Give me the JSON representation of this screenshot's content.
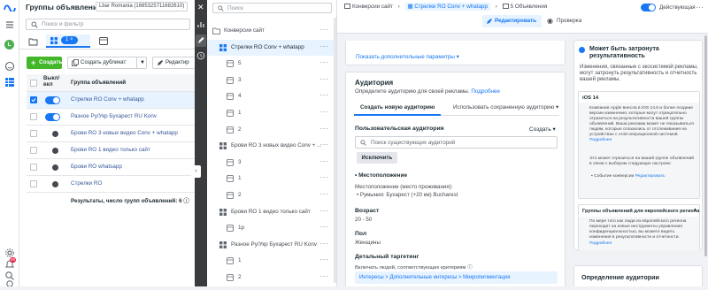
{
  "rail": {
    "icons": [
      "meta-logo-icon",
      "menu-icon",
      "avatar",
      "smile-icon",
      "grid-icon",
      "settings-icon",
      "notifications-icon",
      "search-icon",
      "help-icon",
      "bug-icon"
    ],
    "avatar_letter": "L",
    "notif_count": "99"
  },
  "left_panel": {
    "title": "Группы объявлений",
    "account": "Lbar Romania (1685325711682610)",
    "search_placeholder": "Поиск и фильтр",
    "selected_count": "1",
    "toolbar": {
      "create": "Создать",
      "duplicate": "Создать дубликат",
      "edit": "Редактир"
    },
    "table": {
      "header_toggle": "Выкл/ вкл",
      "header_name": "Группа объявлений",
      "rows": [
        {
          "name": "Стрелки RO Conv + whatapp",
          "on": true,
          "selected": true
        },
        {
          "name": "Разное Ру/Укр Бухарест RU Konv",
          "on": true,
          "selected": false
        },
        {
          "name": "Брови RO 3 новых видео Conv + whatapp",
          "on": false,
          "selected": false
        },
        {
          "name": "Брови RO 1 видео только сайт",
          "on": false,
          "selected": false
        },
        {
          "name": "Брови RO whatsapp",
          "on": false,
          "selected": false
        },
        {
          "name": "Стрелки RO",
          "on": false,
          "selected": false
        }
      ],
      "footer": "Результаты, число групп объявлений: 6"
    }
  },
  "tree": {
    "search_placeholder": "Поиск",
    "nodes": [
      {
        "label": "Конверсии сайт",
        "type": "campaign",
        "indent": 0,
        "selected": false
      },
      {
        "label": "Стрелки RO Conv + whatapp",
        "type": "adset",
        "indent": 1,
        "selected": true
      },
      {
        "label": "5",
        "type": "ad",
        "indent": 2,
        "selected": false
      },
      {
        "label": "3",
        "type": "ad",
        "indent": 2,
        "selected": false
      },
      {
        "label": "4",
        "type": "ad",
        "indent": 2,
        "selected": false
      },
      {
        "label": "1",
        "type": "ad",
        "indent": 2,
        "selected": false
      },
      {
        "label": "2",
        "type": "ad",
        "indent": 2,
        "selected": false
      },
      {
        "label": "Брови RO 3 новых видео Conv + ...",
        "type": "adset",
        "indent": 1,
        "selected": false
      },
      {
        "label": "3",
        "type": "ad",
        "indent": 2,
        "selected": false
      },
      {
        "label": "1",
        "type": "ad",
        "indent": 2,
        "selected": false
      },
      {
        "label": "2",
        "type": "ad",
        "indent": 2,
        "selected": false
      },
      {
        "label": "Брови RO 1 видео только сайт",
        "type": "adset",
        "indent": 1,
        "selected": false
      },
      {
        "label": "1р",
        "type": "ad",
        "indent": 2,
        "selected": false
      },
      {
        "label": "Разное Ру/Укр Бухарест RU Konv",
        "type": "adset",
        "indent": 1,
        "selected": false
      },
      {
        "label": "1",
        "type": "ad",
        "indent": 2,
        "selected": false
      },
      {
        "label": "2",
        "type": "ad",
        "indent": 2,
        "selected": false
      }
    ]
  },
  "topbar": {
    "breadcrumbs": [
      "Конверсии сайт",
      "Стрелки RO Conv + whatapp",
      "5 Объявления"
    ],
    "status": "Действующая",
    "edit": "Редактировать",
    "review": "Проверка"
  },
  "editor": {
    "show_more": "Показать дополнительные параметры",
    "audience": {
      "title": "Аудитория",
      "subtitle": "Определите аудиторию для своей рекламы.",
      "more": "Подробнее",
      "tab_new": "Создать новую аудиторию",
      "tab_saved": "Использовать сохраненную аудиторию",
      "custom_label": "Пользовательская аудитория",
      "create_label": "Создать",
      "search_placeholder": "Поиск существующих аудиторий",
      "exclude": "Исключить",
      "location_title": "Местоположение",
      "location_sub": "Местоположение (место проживания):",
      "location_value": "Румыния: Бухарест (+20 км) Bucharest",
      "age_title": "Возраст",
      "age_value": "20 - 50",
      "gender_title": "Пол",
      "gender_value": "Женщины",
      "targeting_title": "Детальный таргетинг",
      "targeting_sub": "Включать людей, соответствующих критериям",
      "targeting_value": "Интересы > Дополнительные интересы > Микропигментация"
    }
  },
  "sidebar": {
    "title": "Может быть затронута результативность",
    "desc": "Изменения, связанные с экосистемой рекламы, могут затронуть результативность и отчетность вашей рекламы.",
    "ios_header": "iOS 14",
    "ios_text": "Компания Apple внесла в iOS 14.5 и более поздние версии изменения, которые могут отрицательно отразиться на результативности вашей группы объявлений. Ваша реклама может не показываться людям, которые отказались от отслеживания на устройствах с этой операционной системой.",
    "ios_link": "Подробнее",
    "ios_text2": "Это может отразиться на вашей группе объявлений в связи с выбором следующих настроек:",
    "ios_bullet": "Событие конверсии",
    "ios_bullet_link": "Редактировать",
    "eu_header": "Группы объявлений для европейского региона",
    "eu_text": "По мере того как люди из европейского региона переходят на новые инструменты управления конфиденциальностью, вы можете видеть изменения в результативности и отчетности.",
    "eu_link": "Подробнее",
    "def_title": "Определение аудитории"
  }
}
